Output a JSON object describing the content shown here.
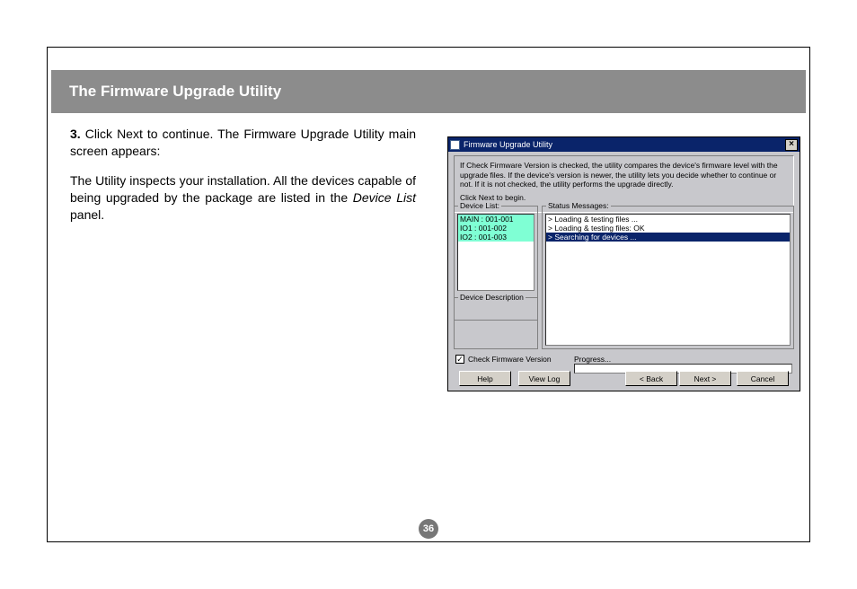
{
  "doc": {
    "header_title": "The Firmware Upgrade Utility",
    "step_num": "3.",
    "para1": " Click Next to continue. The Firmware Upgrade Utility main screen appears:",
    "para2": "The Utility inspects your installation. All the devices capable of being upgraded by the package are listed in the ",
    "para2_italic": "Device List",
    "para2_tail": " panel.",
    "page_number": "36"
  },
  "window": {
    "title": "Firmware Upgrade Utility",
    "close": "×",
    "intro_line1": "If Check Firmware Version is checked, the utility compares the device's firmware level with the upgrade files. If the device's version is newer, the utility lets you decide whether to continue or not. If it is not checked, the utility performs the upgrade directly.",
    "intro_line2": "Click Next to begin.",
    "device_list_label": "Device List:",
    "devices": [
      "MAIN : 001-001",
      "IO1 : 001-002",
      "IO2 : 001-003"
    ],
    "device_desc_label": "Device Description",
    "status_label": "Status Messages:",
    "status_lines": [
      "> Loading & testing files ...",
      "> Loading & testing files: OK",
      "> Searching for devices ..."
    ],
    "check_label": "Check Firmware Version",
    "progress_label": "Progress...",
    "buttons": {
      "help": "Help",
      "view_log": "View Log",
      "back": "< Back",
      "next": "Next >",
      "cancel": "Cancel"
    }
  }
}
